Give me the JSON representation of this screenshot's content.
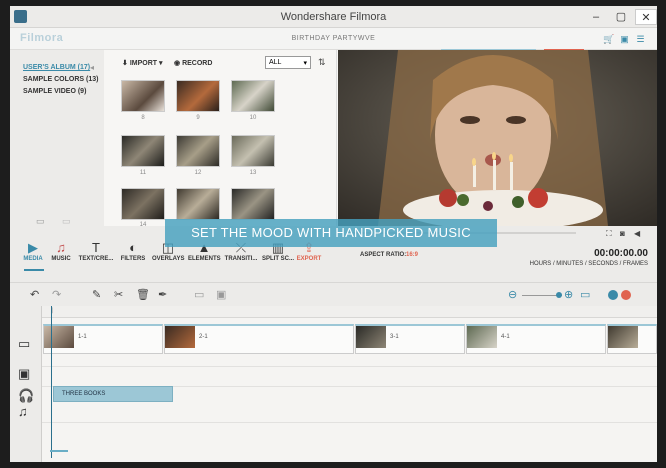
{
  "window": {
    "title": "Wondershare Filmora"
  },
  "header": {
    "logo": "Filmora",
    "project": "BIRTHDAY PARTYWVE"
  },
  "library": {
    "albums": [
      "USER'S ALBUM (17)",
      "SAMPLE COLORS (13)",
      "SAMPLE VIDEO (9)"
    ],
    "import_label": "IMPORT",
    "record_label": "RECORD",
    "filter_value": "ALL",
    "thumbnails": [
      "8",
      "9",
      "10",
      "11",
      "12",
      "13",
      "14",
      "",
      ""
    ]
  },
  "tools": [
    {
      "label": "MEDIA",
      "icon": "media-icon"
    },
    {
      "label": "MUSIC",
      "icon": "music-icon"
    },
    {
      "label": "TEXT/CRE...",
      "icon": "text-icon"
    },
    {
      "label": "FILTERS",
      "icon": "filters-icon"
    },
    {
      "label": "OVERLAYS",
      "icon": "overlays-icon"
    },
    {
      "label": "ELEMENTS",
      "icon": "elements-icon"
    },
    {
      "label": "TRANSITI...",
      "icon": "transition-icon"
    },
    {
      "label": "SPLIT SC...",
      "icon": "split-screen-icon"
    },
    {
      "label": "EXPORT",
      "icon": "export-icon"
    }
  ],
  "preview": {
    "aspect_label": "ASPECT RATIO:",
    "aspect_value": "16:9",
    "timecode": "00:00:00.00",
    "timecode_units": "HOURS / MINUTES / SECONDS / FRAMES"
  },
  "caption": "SET THE MOOD WITH HANDPICKED MUSIC",
  "timeline": {
    "video_clips": [
      "1-1",
      "2-1",
      "3-1",
      "4-1"
    ],
    "audio_clip": "THREE BOOKS"
  },
  "colors": {
    "accent": "#3a8aa8",
    "export": "#e0634f",
    "caption_bg": "#46a0be"
  }
}
